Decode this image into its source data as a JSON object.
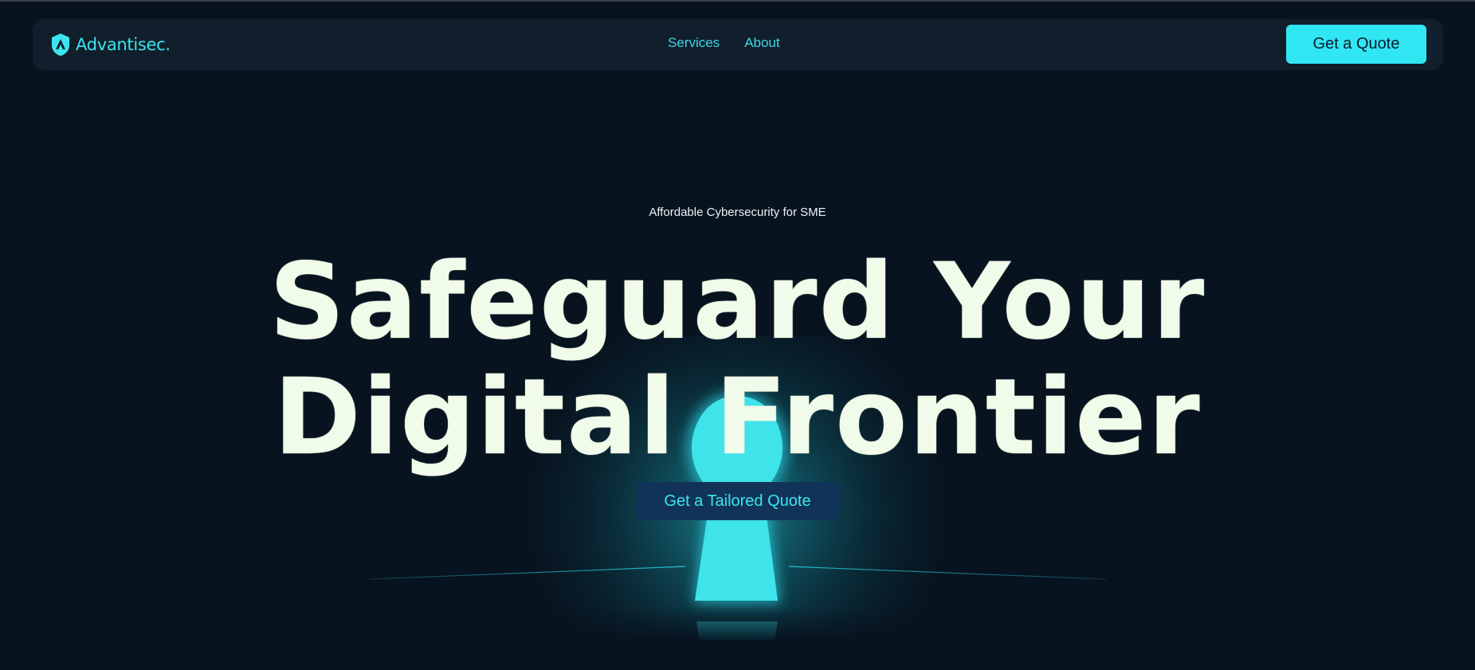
{
  "nav": {
    "logo_text": "Advantisec.",
    "links": [
      {
        "label": "Services"
      },
      {
        "label": "About"
      }
    ],
    "quote_button": "Get a Quote"
  },
  "hero": {
    "tagline": "Affordable Cybersecurity for SME",
    "headline_line1": "Safeguard Your",
    "headline_line2": "Digital Frontier",
    "cta_label": "Get a Tailored Quote"
  },
  "colors": {
    "background": "#07131f",
    "accent": "#2fe6f2",
    "headline": "#f1fbe9",
    "cta_bg": "#123358"
  }
}
